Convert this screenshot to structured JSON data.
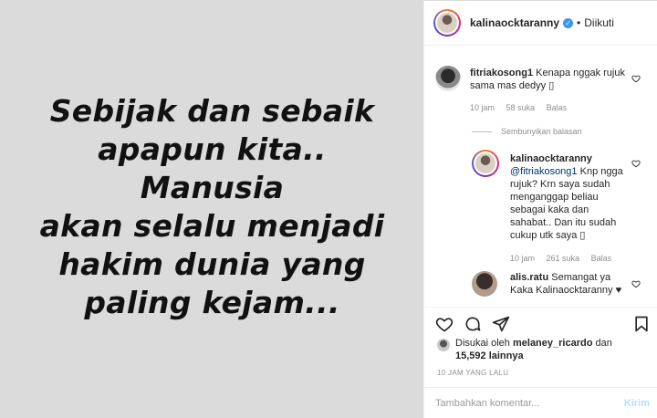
{
  "image": {
    "quote_lines": [
      "Sebijak dan sebaik",
      "apapun kita.. Manusia",
      "akan selalu menjadi",
      "hakim dunia yang",
      "paling kejam..."
    ]
  },
  "header": {
    "username": "kalinaocktaranny",
    "separator": "•",
    "follow_status": "Diikuti"
  },
  "comments": [
    {
      "username": "fitriakosong1",
      "text": "Kenapa nggak rujuk sama mas dedyy ▯",
      "time": "10 jam",
      "likes": "58 suka",
      "reply": "Balas"
    }
  ],
  "hide_replies_label": "Sembunyikan balasan",
  "reply": {
    "username": "kalinaocktaranny",
    "mention": "@fitriakosong1",
    "text": "Knp ngga rujuk? Krn saya sudah menganggap beliau sebagai kaka dan sahabat.. Dan itu sudah cukup utk saya ▯",
    "time": "10 jam",
    "likes": "261 suka",
    "reply": "Balas"
  },
  "comment_alis": {
    "username": "alis.ratu",
    "text": "Semangat ya Kaka Kalinaocktaranny ♥"
  },
  "likes": {
    "prefix": "Disukai oleh",
    "user": "melaney_ricardo",
    "middle": "dan",
    "count": "15,592 lainnya"
  },
  "timestamp": "10 JAM YANG LALU",
  "comment_input": {
    "placeholder": "Tambahkan komentar...",
    "post_label": "Kirim"
  },
  "colors": {
    "accent": "#3897f0",
    "post_disabled": "#b2dffc",
    "image_bg": "#dbdbdb"
  }
}
